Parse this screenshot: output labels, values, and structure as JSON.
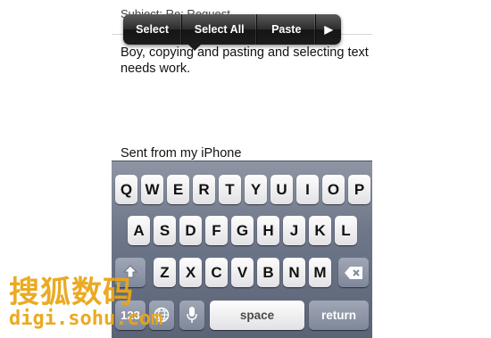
{
  "email": {
    "subject_line": "Subject: Re: Request",
    "body_text": "Boy, copying and pasting and selecting text needs work.",
    "signature": "Sent from my iPhone"
  },
  "edit_menu": {
    "select_label": "Select",
    "select_all_label": "Select All",
    "paste_label": "Paste",
    "more_label": "▶"
  },
  "keyboard": {
    "row1": [
      "Q",
      "W",
      "E",
      "R",
      "T",
      "Y",
      "U",
      "I",
      "O",
      "P"
    ],
    "row2": [
      "A",
      "S",
      "D",
      "F",
      "G",
      "H",
      "J",
      "K",
      "L"
    ],
    "row3": [
      "Z",
      "X",
      "C",
      "V",
      "B",
      "N",
      "M"
    ],
    "shift_icon": "shift-arrow-icon",
    "delete_icon": "delete-backspace-icon",
    "numbers_label": "123",
    "globe_icon": "globe-icon",
    "mic_icon": "microphone-icon",
    "space_label": "space",
    "return_label": "return"
  },
  "watermark": {
    "brand_cn": "搜狐数码",
    "url": "digi.sohu.com"
  }
}
